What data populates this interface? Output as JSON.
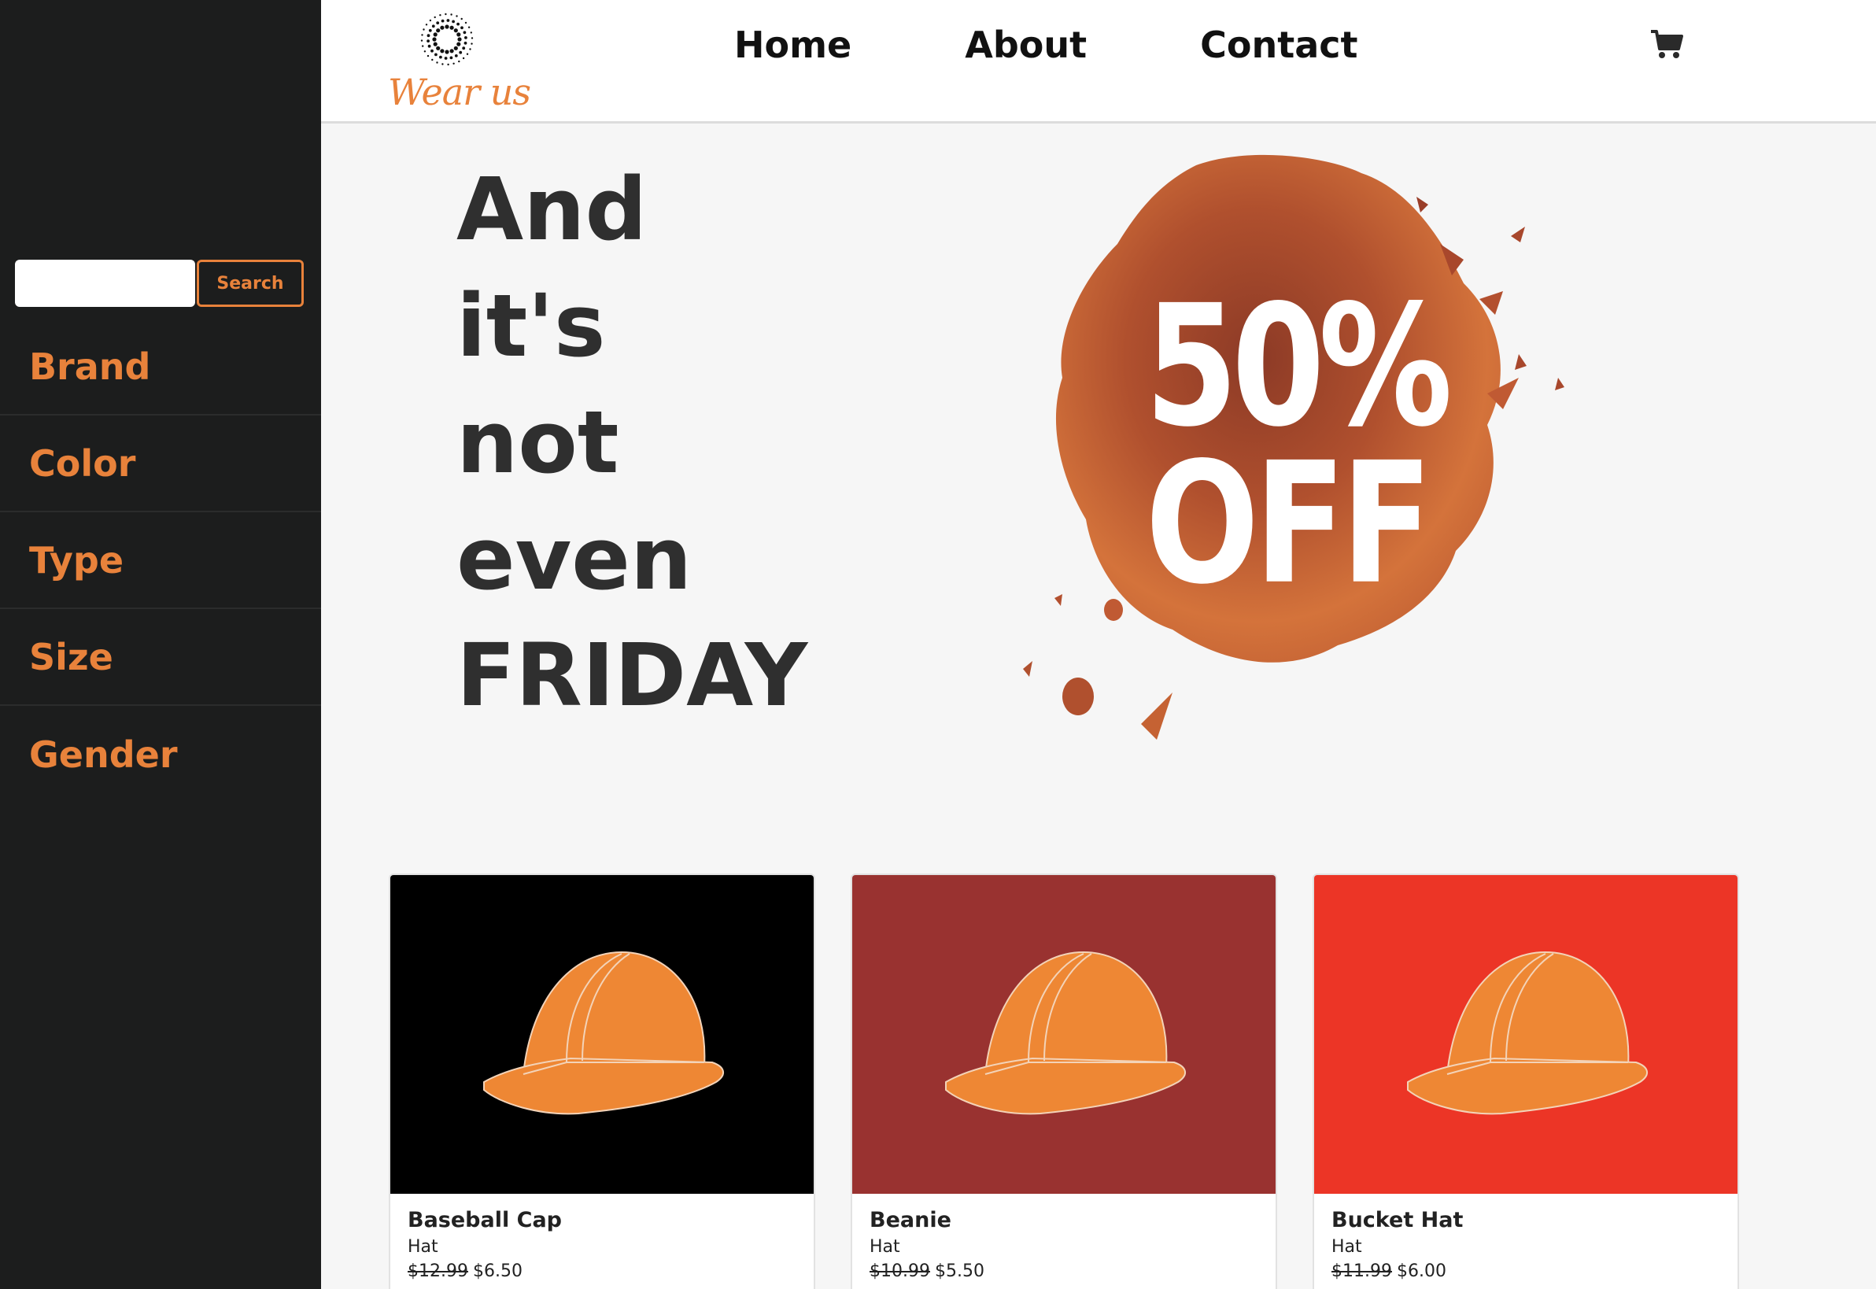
{
  "brand": {
    "logo_text": "Wear us",
    "logo_icon": "sunburst-dots-icon"
  },
  "nav": {
    "items": [
      "Home",
      "About",
      "Contact"
    ],
    "cart_icon": "cart-icon"
  },
  "search": {
    "value": "",
    "placeholder": "",
    "button_label": "Search"
  },
  "sidebar": {
    "filters": [
      "Brand",
      "Color",
      "Type",
      "Size",
      "Gender"
    ]
  },
  "hero": {
    "lines": [
      "And",
      "it's",
      "not",
      "even",
      "FRIDAY"
    ],
    "badge_percent": "50%",
    "badge_off": "OFF"
  },
  "products": [
    {
      "name": "Baseball Cap",
      "type": "Hat",
      "old_price": "$12.99",
      "price": "$6.50",
      "bg": "#000000",
      "icon": "hard-hat-icon"
    },
    {
      "name": "Beanie",
      "type": "Hat",
      "old_price": "$10.99",
      "price": "$5.50",
      "bg": "#993230",
      "icon": "hard-hat-icon"
    },
    {
      "name": "Bucket Hat",
      "type": "Hat",
      "old_price": "$11.99",
      "price": "$6.00",
      "bg": "#ec3526",
      "icon": "hard-hat-icon"
    }
  ],
  "colors": {
    "accent": "#e8823b",
    "sidebar_bg": "#1c1d1d",
    "page_bg": "#f6f6f6",
    "text_dark": "#2f2f2f",
    "badge": "#c8602f"
  }
}
